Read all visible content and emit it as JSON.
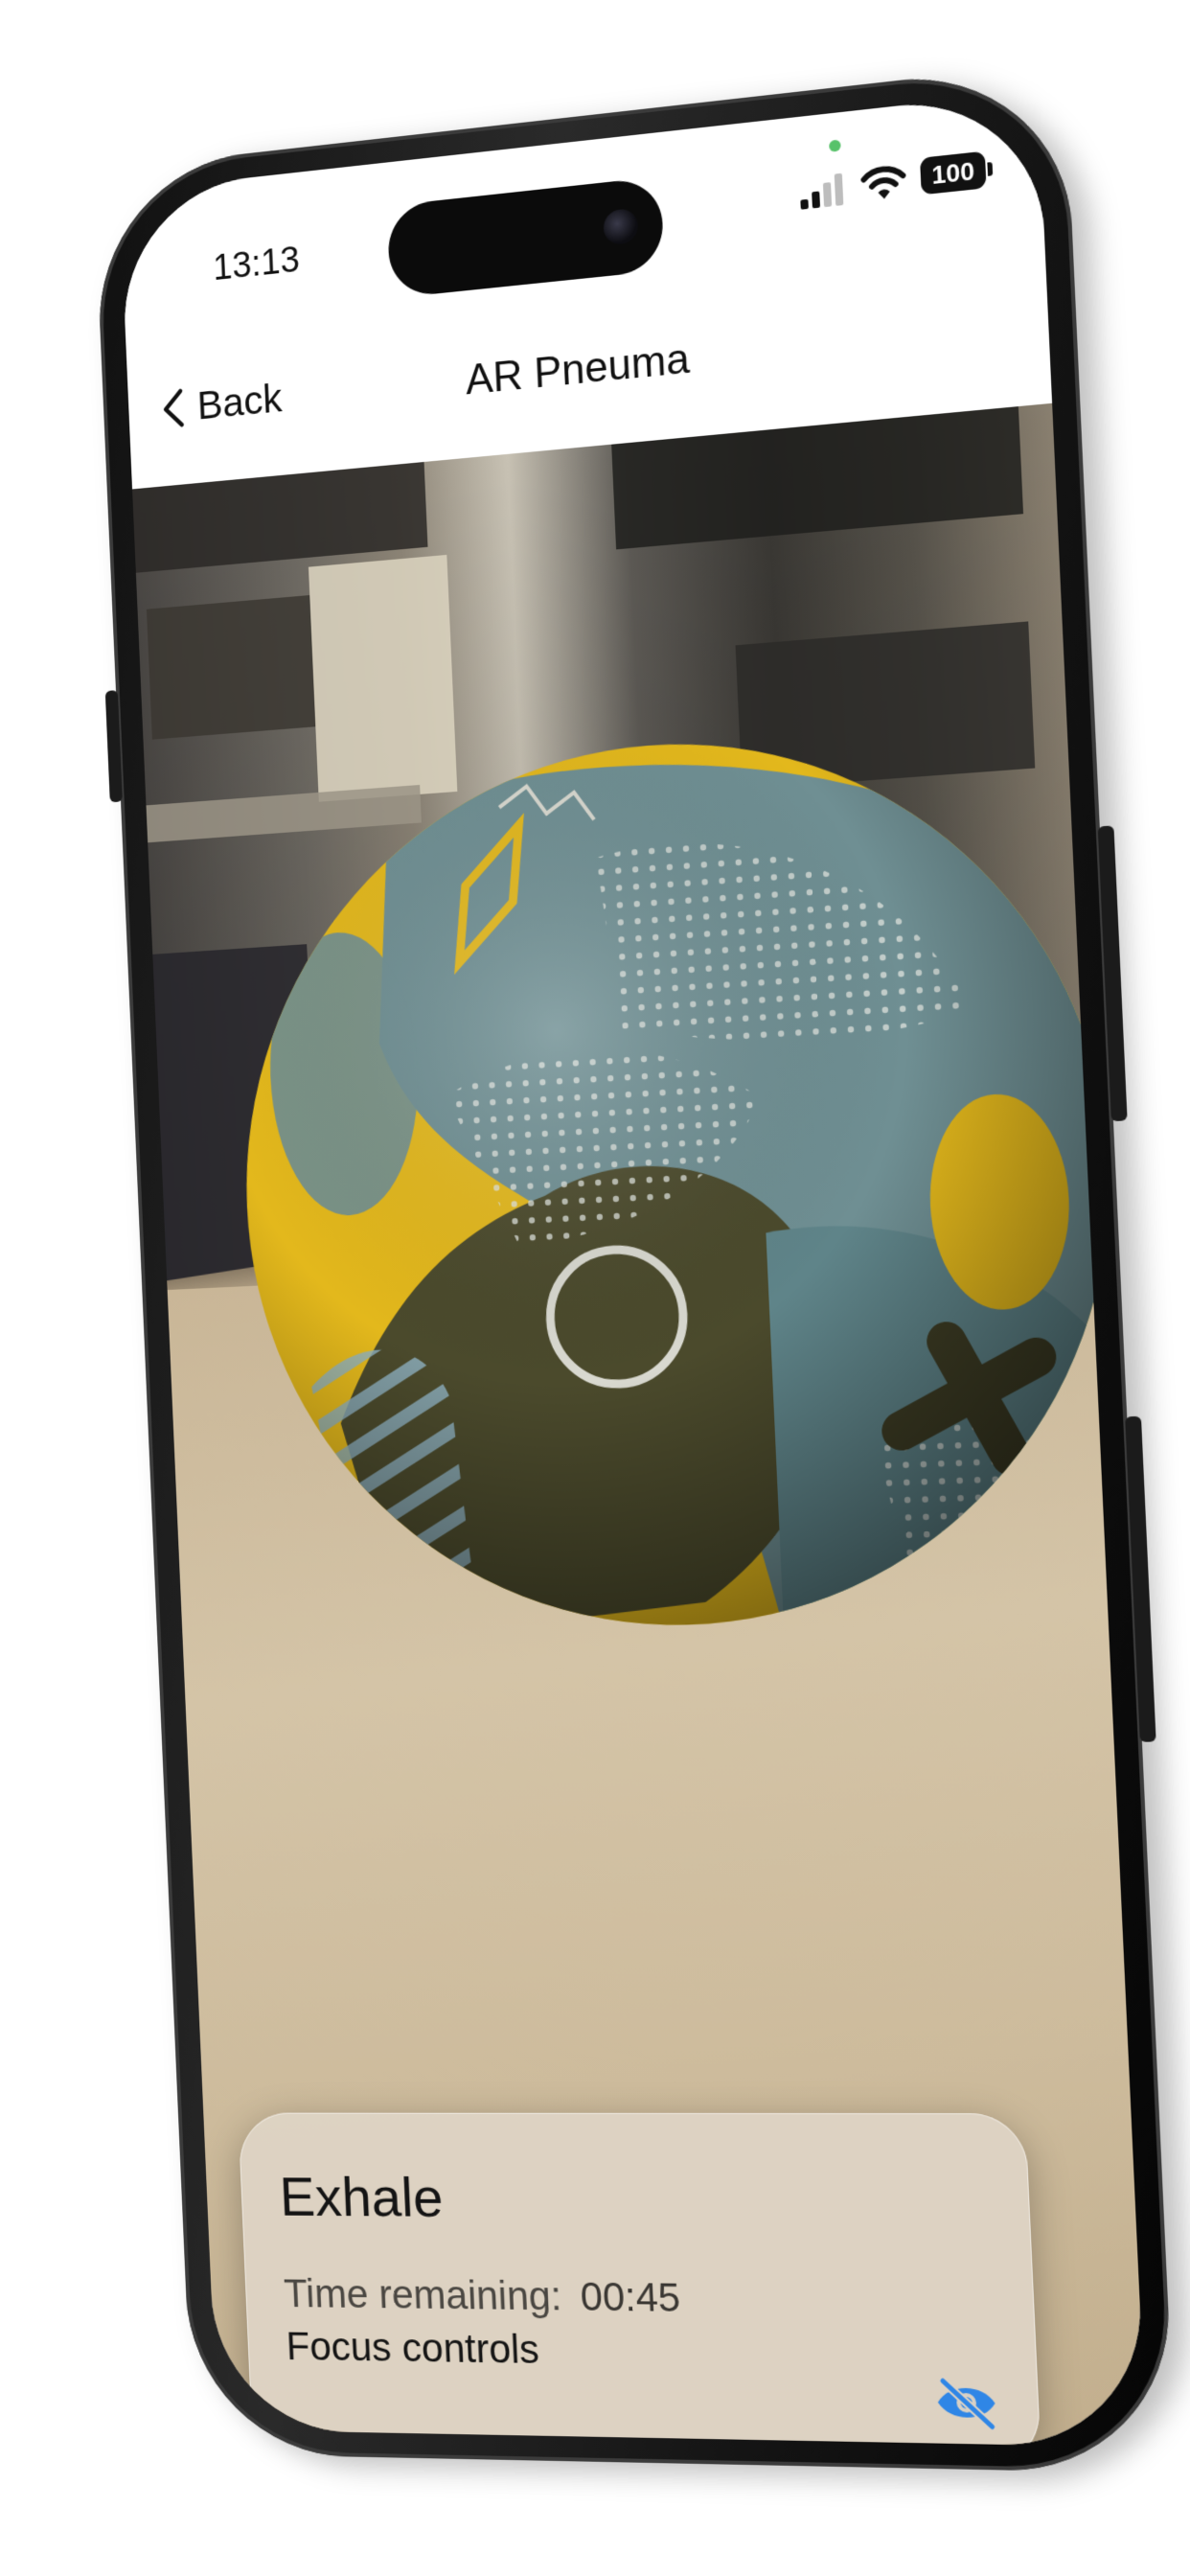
{
  "status_bar": {
    "time": "13:13",
    "battery": "100"
  },
  "nav": {
    "back_label": "Back",
    "title": "AR Pneuma"
  },
  "ar_object": {
    "type": "sphere",
    "colors": {
      "yellow": "#e3b81c",
      "teal": "#6f8f93",
      "dark": "#3f3e24"
    }
  },
  "card": {
    "title": "Exhale",
    "time_label": "Time remaining:",
    "time_value": "00:45",
    "focus_label": "Focus controls",
    "eye_icon": "eye-slash-icon",
    "accent": "#2f86e6"
  },
  "colors": {
    "accent": "#2f86e6"
  }
}
